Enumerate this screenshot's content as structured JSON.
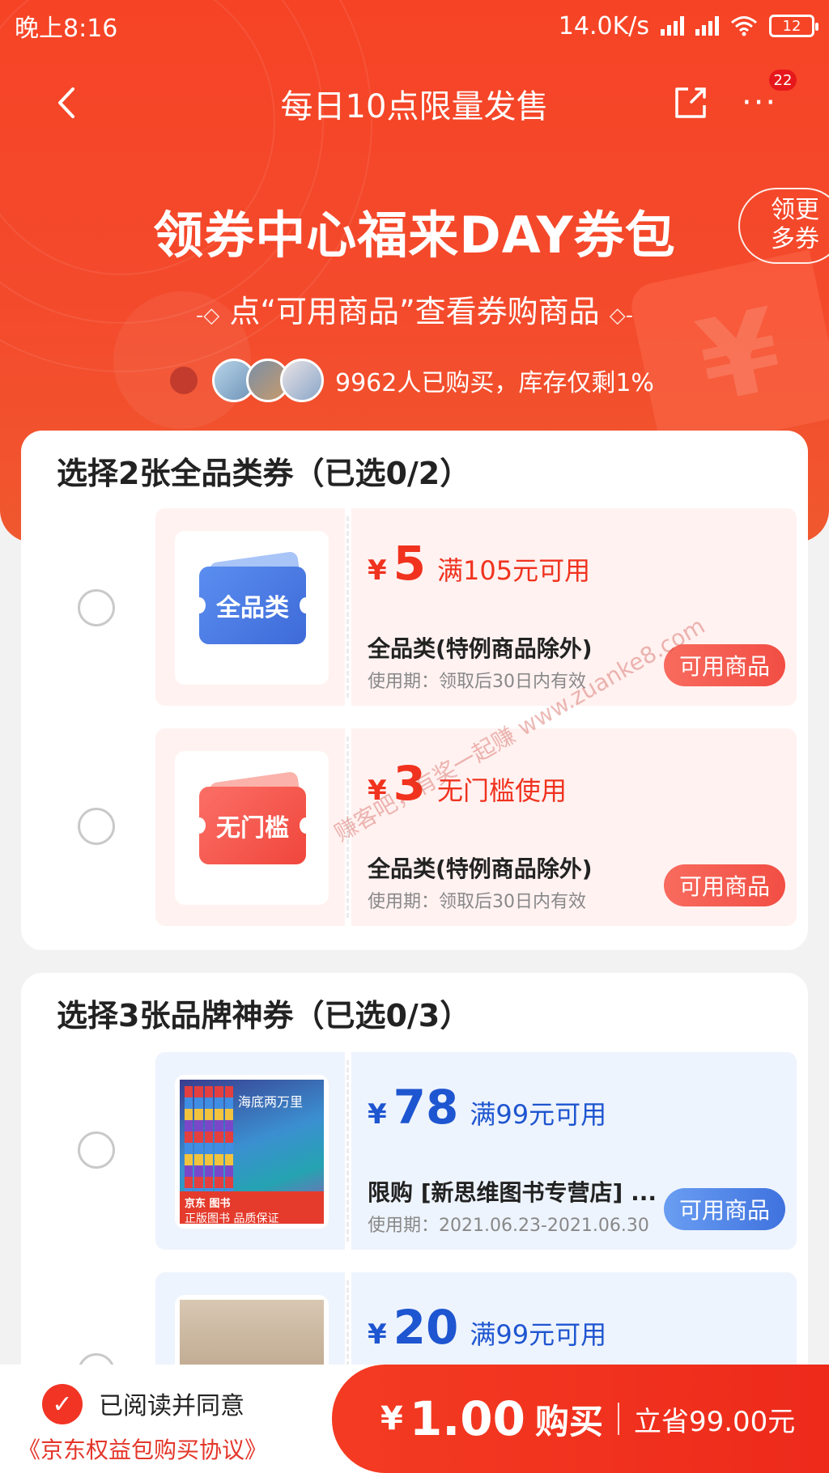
{
  "status_bar": {
    "time": "晚上8:16",
    "net_speed": "14.0K/s",
    "battery": "12"
  },
  "nav": {
    "title": "每日10点限量发售",
    "more_badge": "22"
  },
  "hero": {
    "headline": "领券中心福来DAY券包",
    "more_coupons": "领更多券",
    "subline_left": "-◇",
    "subline": "点“可用商品”查看券购商品",
    "subline_right": "◇-",
    "buyers_text": "9962人已购买，库存仅剩1%"
  },
  "section_all": {
    "title": "选择2张全品类券（已选0/2）",
    "coupons": [
      {
        "tag": "全品类",
        "yen": "¥",
        "amount": "5",
        "condition": "满105元可用",
        "name": "全品类(特例商品除外)",
        "validity": "使用期：领取后30日内有效",
        "button": "可用商品"
      },
      {
        "tag": "无门槛",
        "yen": "¥",
        "amount": "3",
        "condition": "无门槛使用",
        "name": "全品类(特例商品除外)",
        "validity": "使用期：领取后30日内有效",
        "button": "可用商品"
      }
    ]
  },
  "section_brand": {
    "title": "选择3张品牌神券（已选0/3）",
    "coupons": [
      {
        "thumb_title": "海底两万里",
        "thumb_ribbon": "京东 图书",
        "thumb_ribbon2": "正版图书 品质保证",
        "yen": "¥",
        "amount": "78",
        "condition": "满99元可用",
        "name": "限购 [新思维图书专营店] ...",
        "validity": "使用期：2021.06.23-2021.06.30",
        "button": "可用商品"
      },
      {
        "yen": "¥",
        "amount": "20",
        "condition": "满99元可用"
      }
    ]
  },
  "bottom": {
    "agree": "已阅读并同意",
    "agreement_link": "《京东权益包购买协议》",
    "yen": "¥",
    "price": "1.00",
    "buy": "购买",
    "save_label": "立省",
    "save_amount": "99.00元"
  },
  "watermark": "赚客吧，有奖一起赚 www.zuanke8.com",
  "colors": {
    "hero_red": "#f64326",
    "coupon_red": "#f0321e",
    "coupon_blue": "#1e55d0"
  }
}
